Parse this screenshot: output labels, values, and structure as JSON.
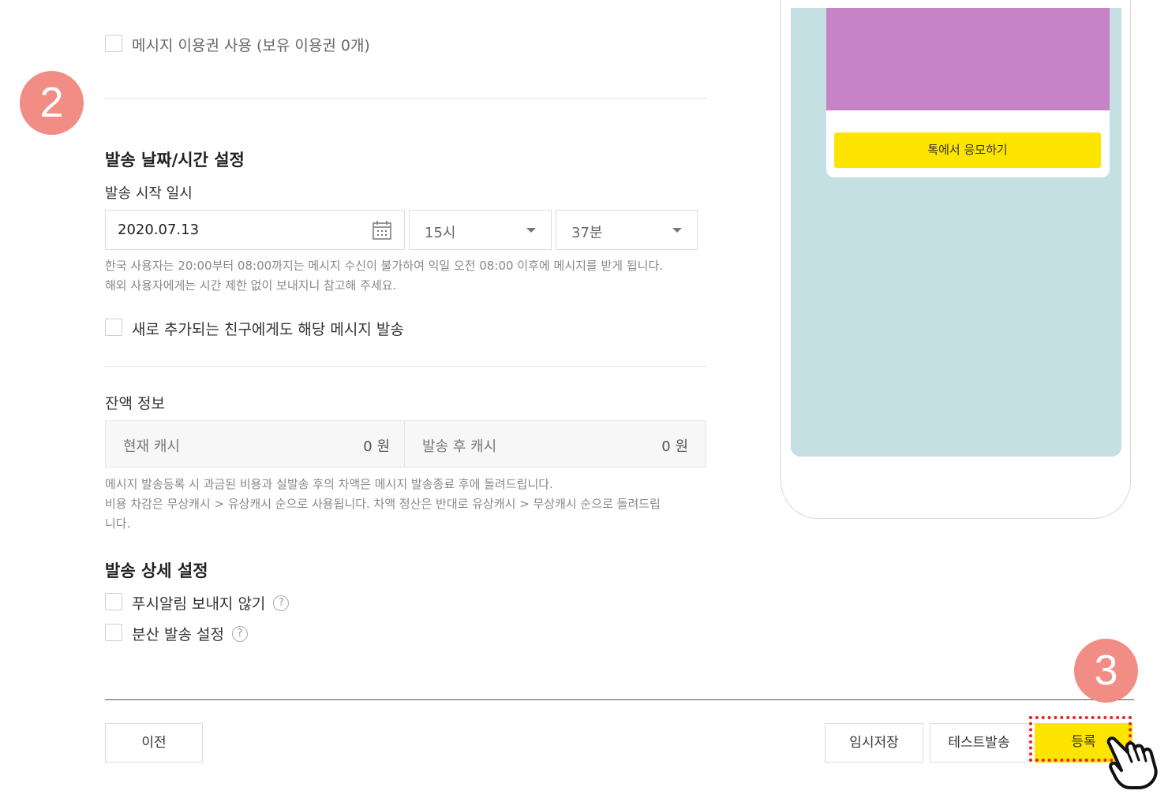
{
  "message_voucher": {
    "label": "메시지 이용권 사용 (보유 이용권 0개)",
    "checked": false
  },
  "step_badges": {
    "step2": "2",
    "step3": "3"
  },
  "schedule": {
    "title": "발송 날짜/시간 설정",
    "start_label": "발송 시작 일시",
    "date": "2020.07.13",
    "hour": "15시",
    "minute": "37분",
    "notice_line1": "한국 사용자는 20:00부터 08:00까지는 메시지 수신이 불가하여 익일 오전 08:00 이후에 메시지를 받게 됩니다.",
    "notice_line2": "해외 사용자에게는 시간 제한 없이 보내지니 참고해 주세요.",
    "new_friends_label": "새로 추가되는 친구에게도 해당 메시지 발송"
  },
  "balance": {
    "title": "잔액 정보",
    "current_label": "현재 캐시",
    "current_value": "0 원",
    "after_label": "발송 후 캐시",
    "after_value": "0 원",
    "note_line1": "메시지 발송등록 시 과금된 비용과 실발송 후의 차액은 메시지 발송종료 후에 돌려드립니다.",
    "note_line2": "비용 차감은 무상캐시 > 유상캐시 순으로 사용됩니다. 차액 정산은 반대로 유상캐시 > 무상캐시 순으로 돌려드립",
    "note_line3": "니다."
  },
  "detail": {
    "title": "발송 상세 설정",
    "no_push_label": "푸시알림 보내지 않기",
    "distributed_label": "분산 발송 설정",
    "help_glyph": "?"
  },
  "preview": {
    "cta_label": "톡에서 응모하기"
  },
  "footer": {
    "prev_label": "이전",
    "draft_label": "임시저장",
    "test_label": "테스트발송",
    "register_label": "등록"
  },
  "colors": {
    "accent_yellow": "#fee500",
    "badge_pink": "#f28d86",
    "preview_bg": "#c5e0e3",
    "preview_image": "#c683c6",
    "highlight_red": "#e8231a"
  }
}
